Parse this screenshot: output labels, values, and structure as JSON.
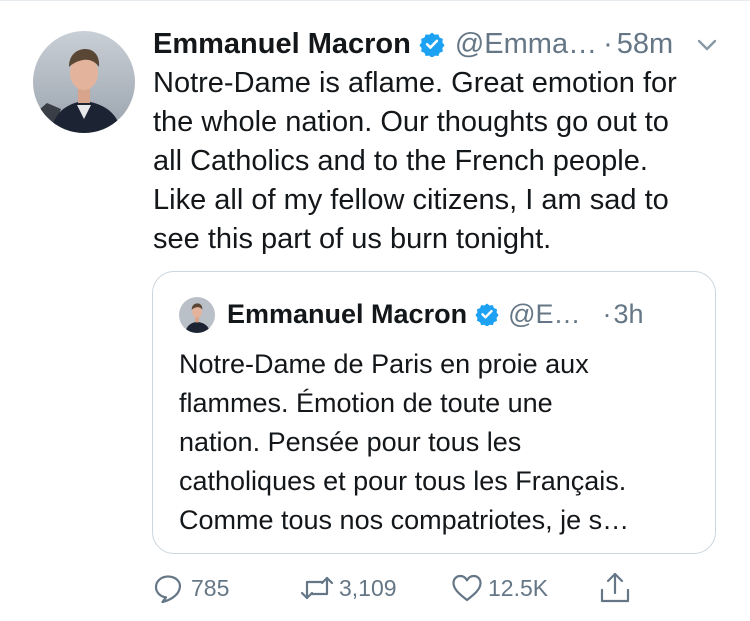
{
  "tweet": {
    "author_name": "Emmanuel Macron",
    "handle": "@Emma…",
    "separator": "·",
    "time": "58m",
    "body_lines": [
      "Notre-Dame is aflame. Great emotion for",
      "the whole nation. Our thoughts go out to",
      "all Catholics and to the French people.",
      "Like all of my fellow citizens, I am sad to",
      "see this part of us burn tonight."
    ]
  },
  "quoted_tweet": {
    "author_name": "Emmanuel Macron",
    "handle": "@E…",
    "separator": "·",
    "time": "3h",
    "body_lines": [
      "Notre-Dame de Paris en proie aux",
      "flammes. Émotion de toute une",
      "nation. Pensée pour tous les",
      "catholiques et pour tous les Français.",
      "Comme tous nos compatriotes, je s…"
    ]
  },
  "actions": {
    "replies": "785",
    "retweets": "3,109",
    "likes": "12.5K"
  },
  "colors": {
    "text": "#14171a",
    "secondary": "#657786",
    "verified": "#1da1f2",
    "border": "#ccd6dd"
  },
  "icons": [
    "verified-badge-icon",
    "chevron-down-icon",
    "reply-icon",
    "retweet-icon",
    "like-icon",
    "share-icon"
  ]
}
